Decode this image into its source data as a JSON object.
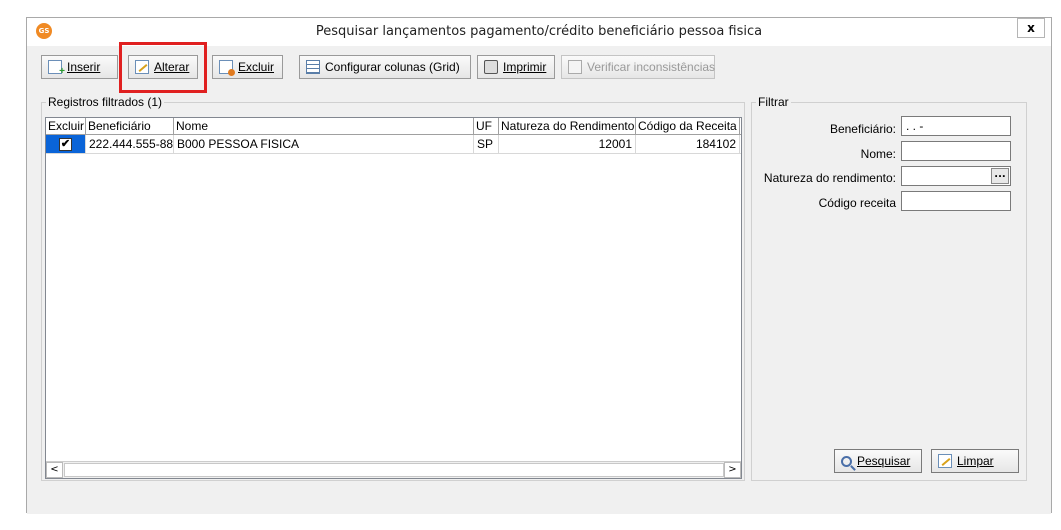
{
  "window": {
    "title": "Pesquisar lançamentos pagamento/crédito beneficiário pessoa fisica",
    "app_icon": "GS",
    "close_label": "x"
  },
  "toolbar": {
    "insert_label": "Inserir",
    "alter_label": "Alterar",
    "delete_label": "Excluir",
    "config_label": "Configurar colunas (Grid)",
    "print_label": "Imprimir",
    "verify_label": "Verificar inconsistências"
  },
  "records": {
    "group_title": "Registros filtrados (1)",
    "columns": [
      "Excluir",
      "Beneficiário",
      "Nome",
      "UF",
      "Natureza do Rendimento",
      "Código da Receita"
    ],
    "rows": [
      {
        "excluir": "✔",
        "beneficiario": "222.444.555-88",
        "nome": "B000 PESSOA FISICA",
        "uf": "SP",
        "natureza": "12001",
        "codigo": "184102"
      }
    ]
  },
  "filter": {
    "group_title": "Filtrar",
    "beneficiario_label": "Beneficiário:",
    "beneficiario_value": " .   .   -",
    "nome_label": "Nome:",
    "nome_value": "",
    "natureza_label": "Natureza do rendimento:",
    "natureza_value": "",
    "natureza_btn": "...",
    "codigo_label": "Código receita",
    "codigo_value": "",
    "search_label": "Pesquisar",
    "clear_label": "Limpar"
  }
}
